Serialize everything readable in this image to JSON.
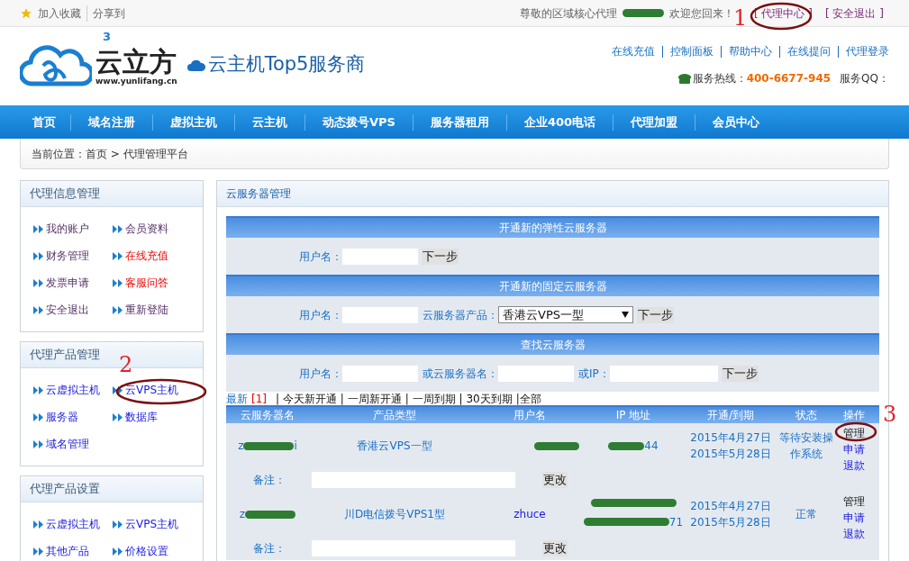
{
  "top_bar": {
    "left_links": [
      "加入收藏",
      "分享到"
    ],
    "greeting_prefix": "尊敬的区域核心代理",
    "greeting_suffix": "欢迎您回来！",
    "right_links": [
      "[ 代理中心 ]",
      "[ 安全退出 ]"
    ]
  },
  "header": {
    "logo_name": "云立方",
    "logo_url": "www.yunlifang.cn",
    "logo_sup": "3",
    "slogan": "云主机Top5服务商",
    "links": [
      "在线充值",
      "控制面板",
      "帮助中心",
      "在线提问",
      "代理登录"
    ],
    "hotline_label": "服务热线：",
    "hotline": "400-6677-945",
    "qq_label": "服务QQ："
  },
  "nav": [
    "首页",
    "域名注册",
    "虚拟主机",
    "云主机",
    "动态拨号VPS",
    "服务器租用",
    "企业400电话",
    "代理加盟",
    "会员中心"
  ],
  "breadcrumb": "当前位置：首页 > 代理管理平台",
  "sidebar": [
    {
      "title": "代理信息管理",
      "items": [
        {
          "label": "我的账户",
          "kind": "normal"
        },
        {
          "label": "会员资料",
          "kind": "normal"
        },
        {
          "label": "财务管理",
          "kind": "normal"
        },
        {
          "label": "在线充值",
          "kind": "alert"
        },
        {
          "label": "发票申请",
          "kind": "normal"
        },
        {
          "label": "客服问答",
          "kind": "alert"
        },
        {
          "label": "安全退出",
          "kind": "normal"
        },
        {
          "label": "重新登陆",
          "kind": "normal"
        }
      ]
    },
    {
      "title": "代理产品管理",
      "items": [
        {
          "label": "云虚拟主机",
          "kind": "link"
        },
        {
          "label": "云VPS主机",
          "kind": "link"
        },
        {
          "label": "服务器",
          "kind": "link"
        },
        {
          "label": "数据库",
          "kind": "link"
        },
        {
          "label": "域名管理",
          "kind": "link"
        }
      ]
    },
    {
      "title": "代理产品设置",
      "items": [
        {
          "label": "云虚拟主机",
          "kind": "link"
        },
        {
          "label": "云VPS主机",
          "kind": "link"
        },
        {
          "label": "其他产品",
          "kind": "link"
        },
        {
          "label": "价格设置",
          "kind": "link"
        }
      ]
    }
  ],
  "main": {
    "title": "云服务器管理",
    "forms": [
      {
        "title": "开通新的弹性云服务器",
        "fields": [
          {
            "label": "用户名：",
            "kind": "input"
          }
        ],
        "button": "下一步"
      },
      {
        "title": "开通新的固定云服务器",
        "fields": [
          {
            "label": "用户名：",
            "kind": "input"
          },
          {
            "label": "云服务器产品：",
            "kind": "select",
            "value": "香港云VPS一型"
          }
        ],
        "button": "下一步"
      },
      {
        "title": "查找云服务器",
        "fields": [
          {
            "label": "用户名：",
            "kind": "input"
          },
          {
            "label": "或云服务器名：",
            "kind": "input"
          },
          {
            "label": "或IP：",
            "kind": "wide"
          }
        ],
        "button": "下一步"
      }
    ],
    "filters": [
      {
        "label": "最新",
        "count": "[1]"
      },
      {
        "label": "| 今天新开通"
      },
      {
        "label": "| 一周新开通"
      },
      {
        "label": "| 一周到期"
      },
      {
        "label": "| 30天到期"
      },
      {
        "label": "|全部"
      }
    ],
    "table": {
      "columns": [
        "云服务器名",
        "产品类型",
        "用户名",
        "IP 地址",
        "开通/到期",
        "状态",
        "操作"
      ],
      "rows": [
        {
          "name_prefix": "z",
          "name_suffix": "i",
          "product": "香港云VPS一型",
          "ip_lines": [
            {
              "kind": "partial",
              "suffix": "44"
            }
          ],
          "opened": "2015年4月27日",
          "expires": "2015年5月28日",
          "status": "等待安装操作系统",
          "actions": [
            "管理",
            "申请",
            "退款"
          ],
          "note_label": "备注：",
          "note_button": "更改"
        },
        {
          "name_prefix": "z",
          "product": "川D电信拨号VPS1型",
          "user": "zhuce",
          "ip_lines": [
            {
              "kind": "hidden"
            },
            {
              "kind": "partial",
              "suffix": "71"
            }
          ],
          "opened": "2015年4月27日",
          "expires": "2015年5月28日",
          "status": "正常",
          "actions": [
            "管理",
            "申请",
            "退款"
          ],
          "note_label": "备注：",
          "note_button": "更改"
        }
      ]
    }
  },
  "annotations": [
    "1",
    "2",
    "3"
  ]
}
